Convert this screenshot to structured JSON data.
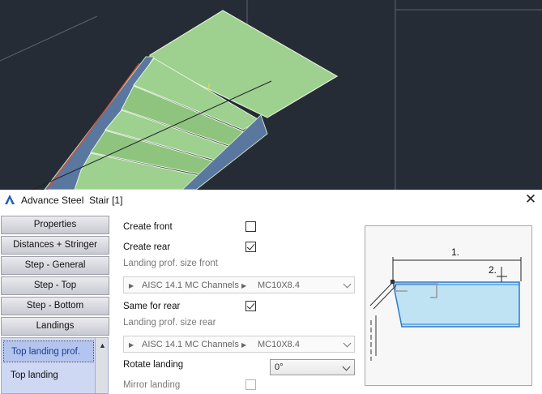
{
  "dialog": {
    "app_name": "Advance Steel",
    "title": "Stair [1]",
    "close_glyph": "✕"
  },
  "nav": {
    "buttons": [
      "Properties",
      "Distances + Stringer",
      "Step - General",
      "Step - Top",
      "Step - Bottom",
      "Landings"
    ],
    "sub_items": [
      "Top landing prof.",
      "Top landing"
    ],
    "selected_sub_item": "Top landing prof."
  },
  "form": {
    "create_front": {
      "label": "Create front",
      "checked": false
    },
    "create_rear": {
      "label": "Create rear",
      "checked": true
    },
    "landing_front": {
      "label": "Landing prof. size front",
      "standard": "AISC 14.1 MC Channels",
      "size": "MC10X8.4"
    },
    "same_for_rear": {
      "label": "Same for rear",
      "checked": true
    },
    "landing_rear": {
      "label": "Landing prof. size rear",
      "standard": "AISC 14.1 MC Channels",
      "size": "MC10X8.4"
    },
    "rotate_landing": {
      "label": "Rotate landing",
      "value": "0°"
    },
    "mirror_landing": {
      "label": "Mirror landing",
      "checked": false,
      "enabled": false
    }
  },
  "preview": {
    "dim_labels": [
      "1.",
      "2."
    ]
  },
  "colors": {
    "viewport_bg": "#262c36",
    "stair_green": "#a8d99a",
    "stringer_blue": "#5a77a0",
    "nav_selected": "#b3c5ef",
    "preview_fill": "#bfe3f3"
  }
}
